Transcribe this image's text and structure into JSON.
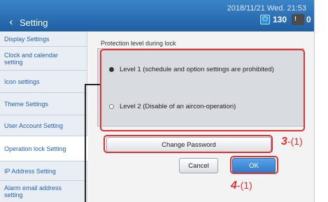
{
  "header": {
    "back_glyph": "‹",
    "title": "Setting",
    "datetime": "2018/11/21 Wed. 21:53",
    "power_count": "130",
    "alarm_count": "0",
    "power_icon_glyph": "⏻",
    "alarm_icon_glyph": "!"
  },
  "sidebar": {
    "items": [
      {
        "label": "Display Settings"
      },
      {
        "label": "Clock and calendar setting"
      },
      {
        "label": "Icon settings"
      },
      {
        "label": "Theme Settings"
      },
      {
        "label": "User Account Setting"
      },
      {
        "label": "Operation lock Setting"
      },
      {
        "label": "IP Address Setting"
      },
      {
        "label": "Alarm email address setting"
      }
    ]
  },
  "main": {
    "section_label": "Protection level during lock",
    "options": [
      {
        "label": "Level 1 (schedule and option settings are prohibited)",
        "checked": true
      },
      {
        "label": "Level 2 (Disable of an aircon-operation)",
        "checked": false
      }
    ],
    "change_password_label": "Change Password",
    "cancel_label": "Cancel",
    "ok_label": "OK"
  },
  "annotations": {
    "a3_main": "3",
    "a3_sub": "-(1)",
    "a4_main": "4",
    "a4_sub": "-(1)"
  },
  "colors": {
    "header": "#2a6db5",
    "accent": "#2464b0",
    "annotation": "#e03030"
  }
}
